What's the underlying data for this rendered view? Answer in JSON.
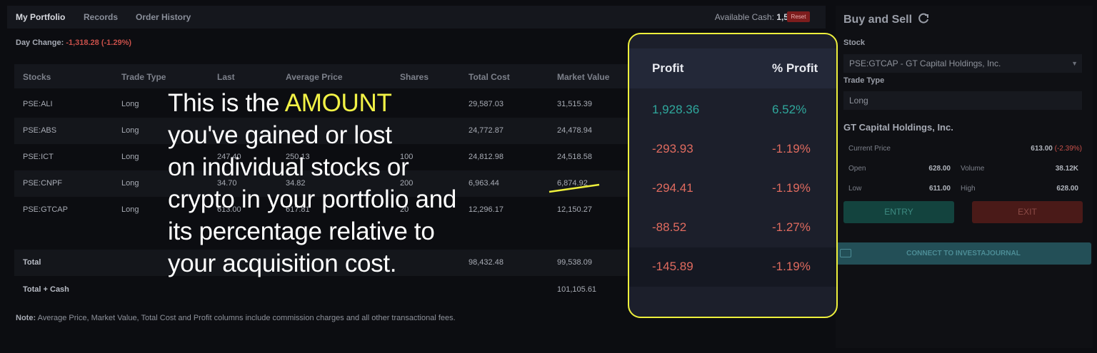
{
  "tabs": {
    "my_portfolio": "My Portfolio",
    "records": "Records",
    "order_history": "Order History"
  },
  "cash": {
    "label": "Available Cash:",
    "value": "1,567.52",
    "reset": "Reset"
  },
  "day_change": {
    "label": "Day Change:",
    "value": "-1,318.28 (-1.29%)"
  },
  "table": {
    "headers": [
      "Stocks",
      "Trade Type",
      "Last",
      "Average Price",
      "Shares",
      "Total Cost",
      "Market Value"
    ],
    "rows": [
      {
        "stock": "PSE:ALI",
        "type": "Long",
        "last": "",
        "avg": "",
        "shares": "",
        "cost": "29,587.03",
        "market": "31,515.39"
      },
      {
        "stock": "PSE:ABS",
        "type": "Long",
        "last": "",
        "avg": "",
        "shares": "",
        "cost": "24,772.87",
        "market": "24,478.94"
      },
      {
        "stock": "PSE:ICT",
        "type": "Long",
        "last": "247.40",
        "avg": "250.13",
        "shares": "100",
        "cost": "24,812.98",
        "market": "24,518.58"
      },
      {
        "stock": "PSE:CNPF",
        "type": "Long",
        "last": "34.70",
        "avg": "34.82",
        "shares": "200",
        "cost": "6,963.44",
        "market": "6,874.92"
      },
      {
        "stock": "PSE:GTCAP",
        "type": "Long",
        "last": "613.00",
        "avg": "617.81",
        "shares": "20",
        "cost": "12,296.17",
        "market": "12,150.27"
      }
    ],
    "total_label": "Total",
    "total_cost": "98,432.48",
    "total_market": "99,538.09",
    "total_cash_label": "Total + Cash",
    "total_cash_market": "101,105.61"
  },
  "note": {
    "label": "Note:",
    "text": "Average Price, Market Value, Total Cost and Profit columns include commission charges and all other transactional fees."
  },
  "buy_sell": {
    "title": "Buy and Sell",
    "stock_label": "Stock",
    "stock_value": "PSE:GTCAP - GT Capital Holdings, Inc.",
    "trade_type_label": "Trade Type",
    "trade_type_value": "Long",
    "company": "GT Capital Holdings, Inc.",
    "current_price_label": "Current Price",
    "current_price_value": "613.00",
    "current_price_change": "(-2.39%)",
    "open_label": "Open",
    "open_value": "628.00",
    "volume_label": "Volume",
    "volume_value": "38.12K",
    "low_label": "Low",
    "low_value": "611.00",
    "high_label": "High",
    "high_value": "628.00",
    "entry": "ENTRY",
    "exit": "EXIT",
    "connect": "CONNECT TO INVESTAJOURNAL"
  },
  "callout": {
    "line1_pre": "This is the ",
    "line1_hl": "AMOUNT",
    "line2": "you've gained or lost",
    "line3": "on individual stocks or",
    "line4": "crypto in your portfolio and",
    "line5": "its percentage relative to",
    "line6": "your acquisition cost."
  },
  "profit_panel": {
    "col_profit": "Profit",
    "col_pct": "% Profit",
    "rows": [
      {
        "profit": "1,928.36",
        "pct": "6.52%",
        "sign": "pos"
      },
      {
        "profit": "-293.93",
        "pct": "-1.19%",
        "sign": "neg"
      },
      {
        "profit": "-294.41",
        "pct": "-1.19%",
        "sign": "neg"
      },
      {
        "profit": "-88.52",
        "pct": "-1.27%",
        "sign": "neg"
      },
      {
        "profit": "-145.89",
        "pct": "-1.19%",
        "sign": "neg"
      }
    ]
  },
  "colors": {
    "positive": "#2fa89d",
    "negative": "#e06b5f",
    "highlight": "#eef03c",
    "background": "#0c0d11"
  }
}
